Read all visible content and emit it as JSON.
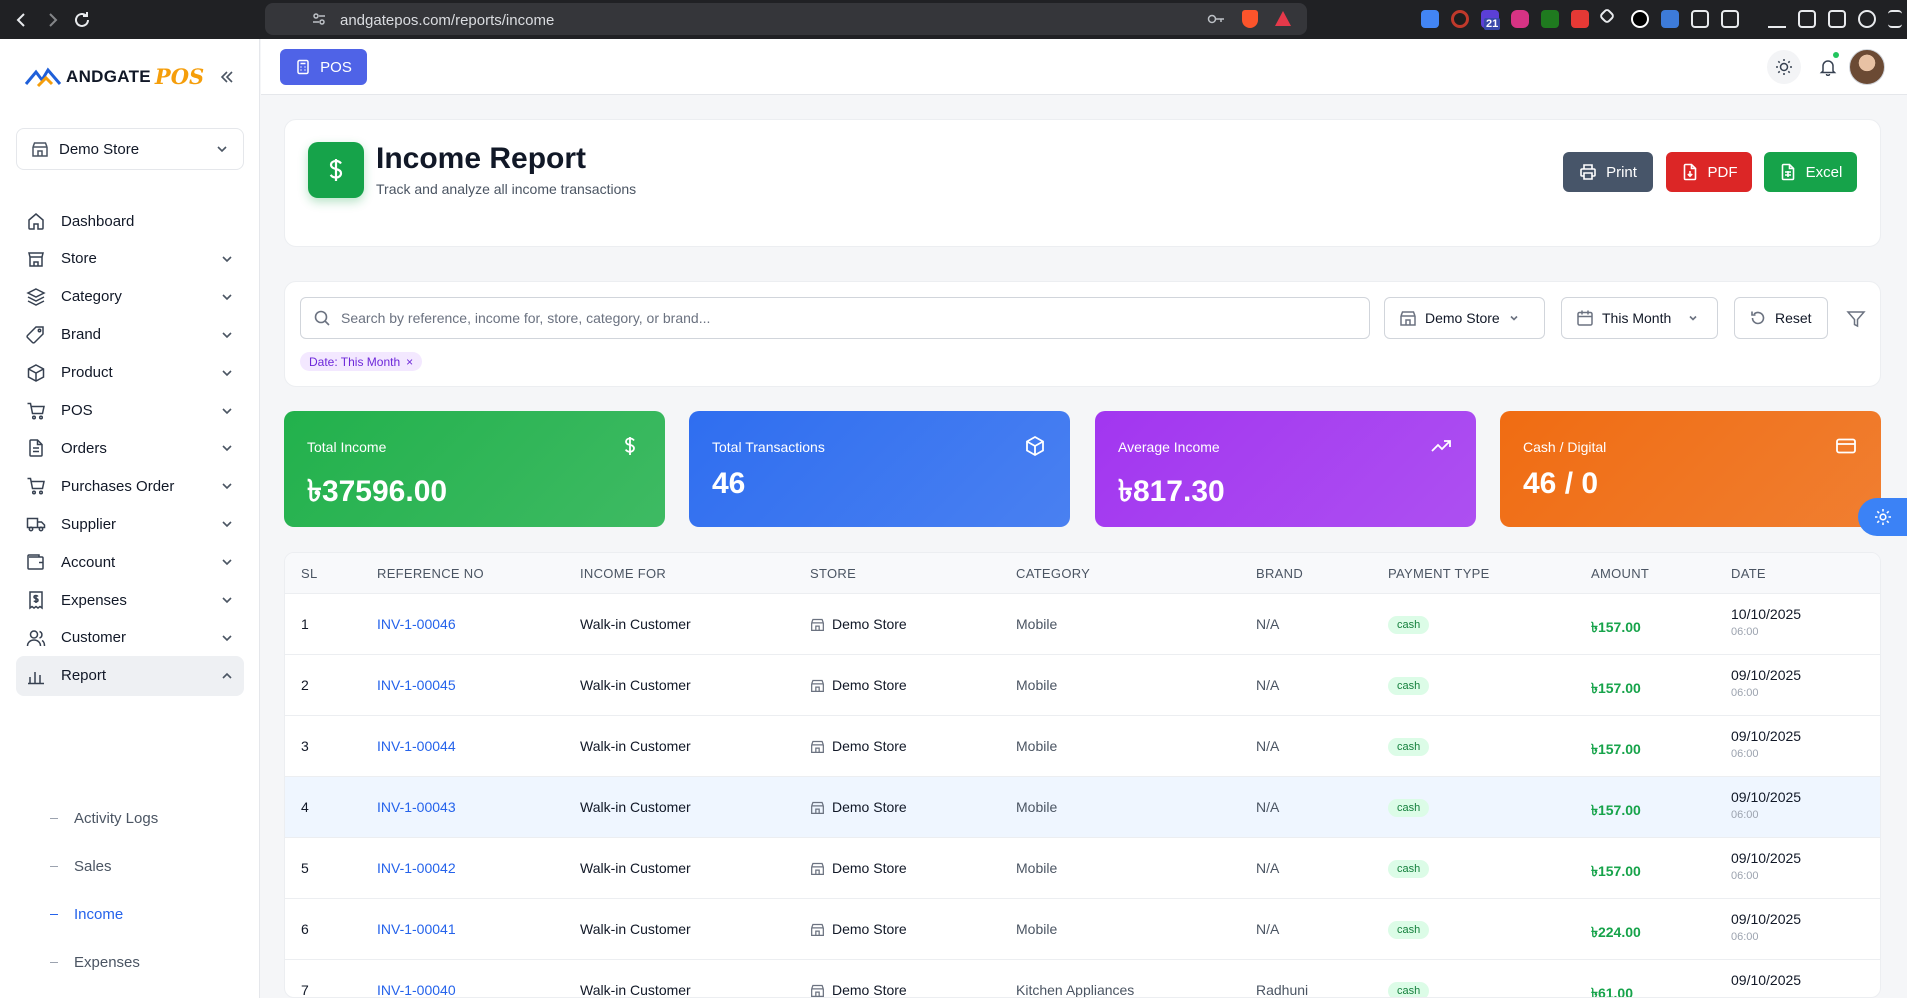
{
  "browser": {
    "url": "andgatepos.com/reports/income",
    "ext_badge": "21"
  },
  "app": {
    "logo_text": "ANDGATE",
    "logo_accent": "POS",
    "store_selector": "Demo Store"
  },
  "sidebar": {
    "items": [
      {
        "label": "Dashboard",
        "icon": "home-icon"
      },
      {
        "label": "Store",
        "icon": "store-icon"
      },
      {
        "label": "Category",
        "icon": "layers-icon"
      },
      {
        "label": "Brand",
        "icon": "tag-icon"
      },
      {
        "label": "Product",
        "icon": "box-icon"
      },
      {
        "label": "POS",
        "icon": "cart-icon"
      },
      {
        "label": "Orders",
        "icon": "document-icon"
      },
      {
        "label": "Purchases Order",
        "icon": "cart-icon"
      },
      {
        "label": "Supplier",
        "icon": "truck-icon"
      },
      {
        "label": "Account",
        "icon": "wallet-icon"
      },
      {
        "label": "Expenses",
        "icon": "receipt-icon"
      },
      {
        "label": "Customer",
        "icon": "users-icon"
      },
      {
        "label": "Report",
        "icon": "bar-chart-icon"
      }
    ],
    "report_sub": [
      "Activity Logs",
      "Sales",
      "Income",
      "Expenses"
    ]
  },
  "topbar": {
    "pos_label": "POS"
  },
  "header": {
    "title": "Income Report",
    "subtitle": "Track and analyze all income transactions",
    "print_label": "Print",
    "pdf_label": "PDF",
    "excel_label": "Excel"
  },
  "filters": {
    "search_placeholder": "Search by reference, income for, store, category, or brand...",
    "store": "Demo Store",
    "period": "This Month",
    "reset_label": "Reset",
    "chip": "Date: This Month",
    "chip_close": "×"
  },
  "stats": [
    {
      "label": "Total Income",
      "value": "৳37596.00",
      "color": "#22b14c"
    },
    {
      "label": "Total Transactions",
      "value": "46",
      "color": "#2f6ef0"
    },
    {
      "label": "Average Income",
      "value": "৳817.30",
      "color": "#a236f0"
    },
    {
      "label": "Cash / Digital",
      "value": "46 / 0",
      "color": "#f06c12"
    }
  ],
  "table": {
    "columns": [
      "SL",
      "REFERENCE NO",
      "INCOME FOR",
      "STORE",
      "CATEGORY",
      "BRAND",
      "PAYMENT TYPE",
      "AMOUNT",
      "DATE"
    ],
    "rows": [
      {
        "sl": "1",
        "ref": "INV-1-00046",
        "for": "Walk-in Customer",
        "store": "Demo Store",
        "category": "Mobile",
        "brand": "N/A",
        "payment": "cash",
        "amount": "৳157.00",
        "date": "10/10/2025",
        "time": "06:00"
      },
      {
        "sl": "2",
        "ref": "INV-1-00045",
        "for": "Walk-in Customer",
        "store": "Demo Store",
        "category": "Mobile",
        "brand": "N/A",
        "payment": "cash",
        "amount": "৳157.00",
        "date": "09/10/2025",
        "time": "06:00"
      },
      {
        "sl": "3",
        "ref": "INV-1-00044",
        "for": "Walk-in Customer",
        "store": "Demo Store",
        "category": "Mobile",
        "brand": "N/A",
        "payment": "cash",
        "amount": "৳157.00",
        "date": "09/10/2025",
        "time": "06:00"
      },
      {
        "sl": "4",
        "ref": "INV-1-00043",
        "for": "Walk-in Customer",
        "store": "Demo Store",
        "category": "Mobile",
        "brand": "N/A",
        "payment": "cash",
        "amount": "৳157.00",
        "date": "09/10/2025",
        "time": "06:00"
      },
      {
        "sl": "5",
        "ref": "INV-1-00042",
        "for": "Walk-in Customer",
        "store": "Demo Store",
        "category": "Mobile",
        "brand": "N/A",
        "payment": "cash",
        "amount": "৳157.00",
        "date": "09/10/2025",
        "time": "06:00"
      },
      {
        "sl": "6",
        "ref": "INV-1-00041",
        "for": "Walk-in Customer",
        "store": "Demo Store",
        "category": "Mobile",
        "brand": "N/A",
        "payment": "cash",
        "amount": "৳224.00",
        "date": "09/10/2025",
        "time": "06:00"
      },
      {
        "sl": "7",
        "ref": "INV-1-00040",
        "for": "Walk-in Customer",
        "store": "Demo Store",
        "category": "Kitchen Appliances",
        "brand": "Radhuni",
        "payment": "cash",
        "amount": "৳61.00",
        "date": "09/10/2025",
        "time": ""
      }
    ]
  }
}
